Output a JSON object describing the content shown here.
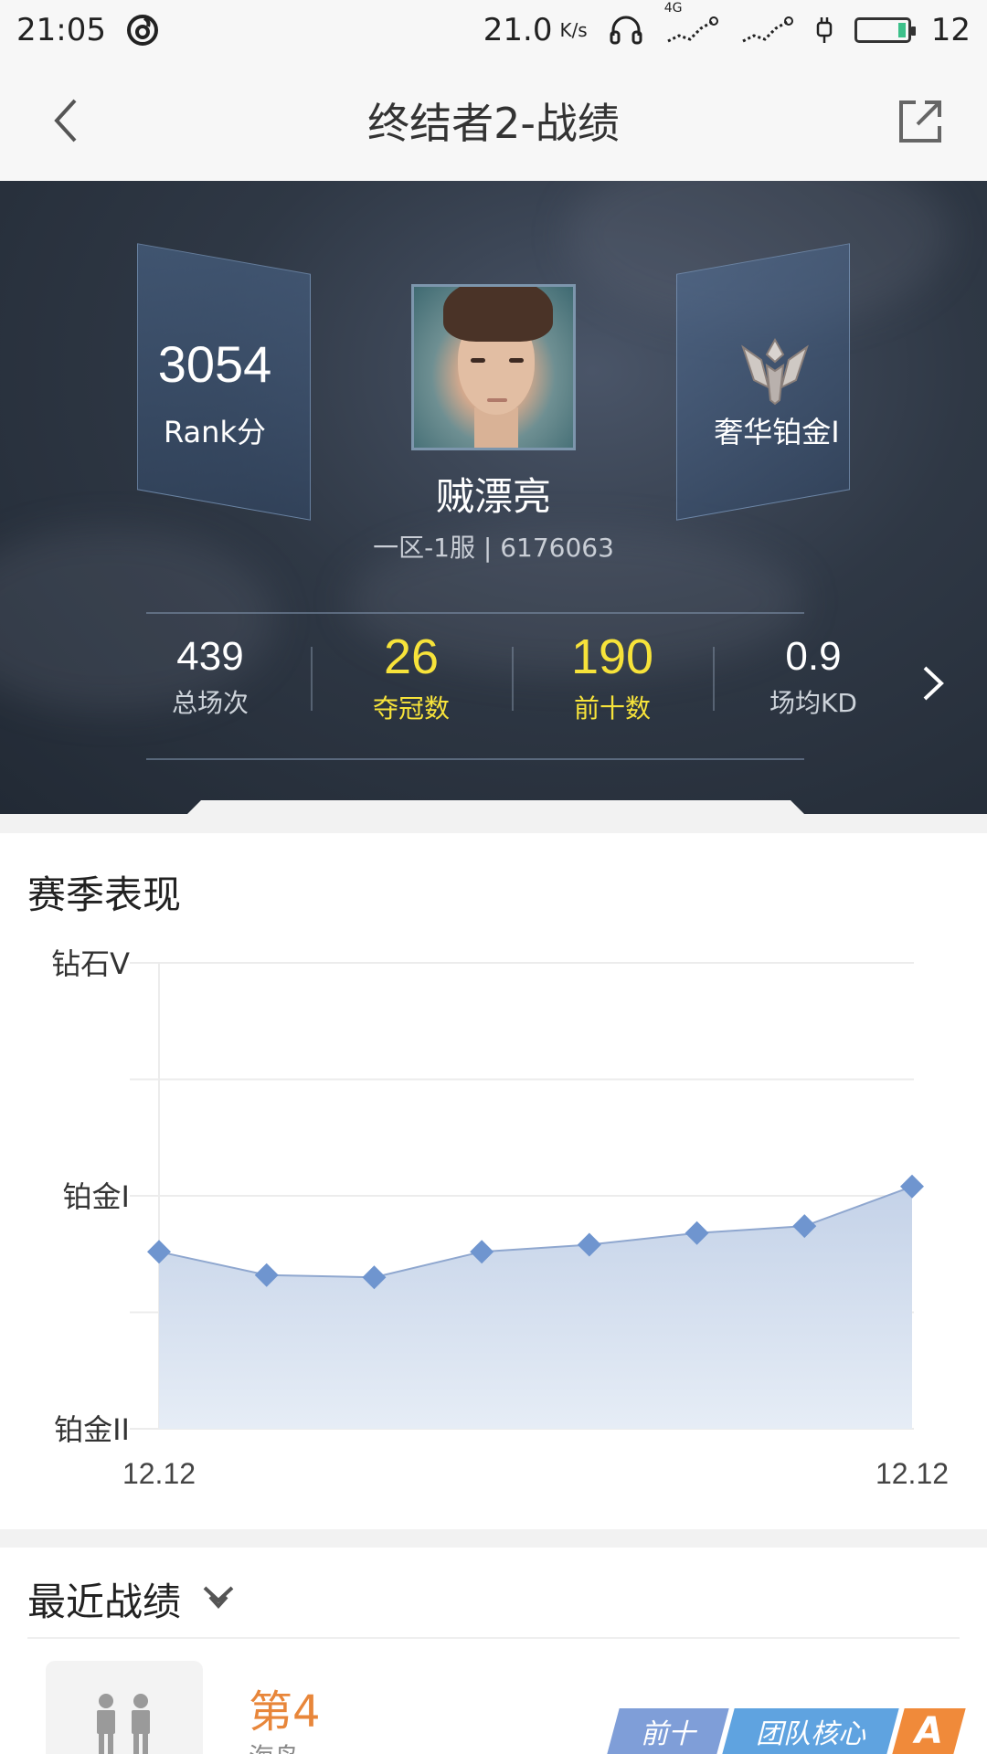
{
  "status_bar": {
    "time": "21:05",
    "net_speed": "21.0",
    "net_unit": "K/s",
    "network": "4G",
    "battery": "12"
  },
  "header": {
    "title": "终结者2-战绩",
    "back_icon": "chevron-left-icon",
    "share_icon": "share-icon"
  },
  "profile": {
    "rank_score": "3054",
    "rank_label": "Rank分",
    "tier": "奢华铂金I",
    "name": "贼漂亮",
    "server": "一区-1服 | 6176063"
  },
  "stats": [
    {
      "value": "439",
      "label": "总场次",
      "highlight": false
    },
    {
      "value": "26",
      "label": "夺冠数",
      "highlight": true
    },
    {
      "value": "190",
      "label": "前十数",
      "highlight": true
    },
    {
      "value": "0.9",
      "label": "场均KD",
      "highlight": false
    }
  ],
  "colors": {
    "highlight": "#f7e33a",
    "accent_orange": "#e8863a",
    "chart_line": "#8fa7cf",
    "chart_marker": "#6f95cf"
  },
  "season": {
    "title": "赛季表现"
  },
  "chart_data": {
    "type": "area",
    "title": "",
    "y_tick_labels": [
      "钻石V",
      "铂金I",
      "铂金II"
    ],
    "x_tick_labels": [
      "12.12",
      "12.12"
    ],
    "ylim": [
      0,
      2
    ],
    "grid": true,
    "values": [
      0.76,
      0.66,
      0.65,
      0.76,
      0.79,
      0.84,
      0.87,
      1.04
    ]
  },
  "recent": {
    "title": "最近战绩",
    "match": {
      "rank": "第4",
      "sub": "海岛",
      "tags": [
        "前十",
        "团队核心",
        "A"
      ]
    }
  }
}
